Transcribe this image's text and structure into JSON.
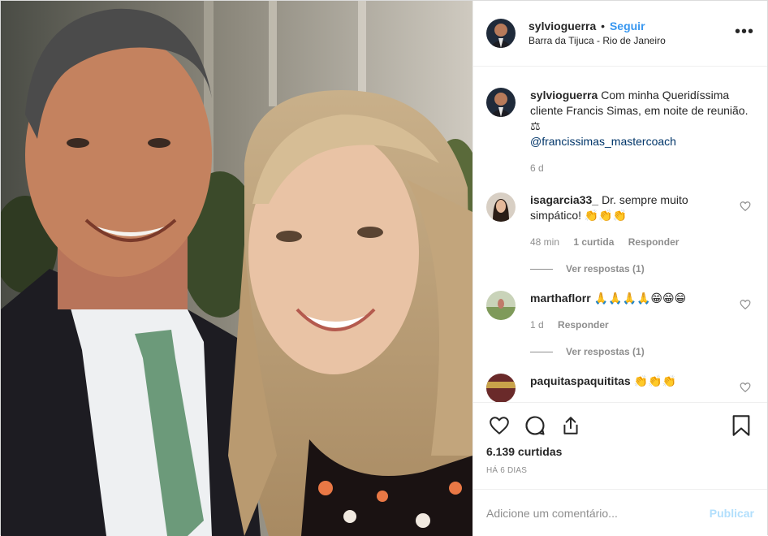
{
  "post": {
    "username": "sylvioguerra",
    "separator": "•",
    "follow_label": "Seguir",
    "location": "Barra da Tijuca - Rio de Janeiro",
    "more_label": "•••"
  },
  "caption": {
    "username": "sylvioguerra",
    "text": "Com minha Queridíssima cliente Francis Simas, em noite de reunião. ⚖",
    "mention": "@francissimas_mastercoach",
    "time": "6 d"
  },
  "comments": [
    {
      "username": "isagarcia33_",
      "text": "Dr. sempre muito simpático! 👏👏👏",
      "time": "48 min",
      "likes": "1 curtida",
      "reply_label": "Responder",
      "view_replies": "Ver respostas (1)"
    },
    {
      "username": "marthaflorr",
      "text": "🙏🙏🙏🙏😁😁😁",
      "time": "1 d",
      "reply_label": "Responder",
      "view_replies": "Ver respostas (1)"
    },
    {
      "username": "paquitaspaquititas",
      "text": "👏👏👏"
    }
  ],
  "actions": {
    "likes_count": "6.139 curtidas",
    "posted_ago": "HÁ 6 DIAS"
  },
  "add_comment": {
    "placeholder": "Adicione um comentário...",
    "publish_label": "Publicar"
  },
  "colors": {
    "link": "#3897f0",
    "mention": "#003569",
    "muted": "#8e8e8e",
    "publish_disabled": "#b2dffc"
  },
  "icons": [
    "heart-icon",
    "comment-icon",
    "share-icon",
    "bookmark-icon",
    "more-icon"
  ]
}
